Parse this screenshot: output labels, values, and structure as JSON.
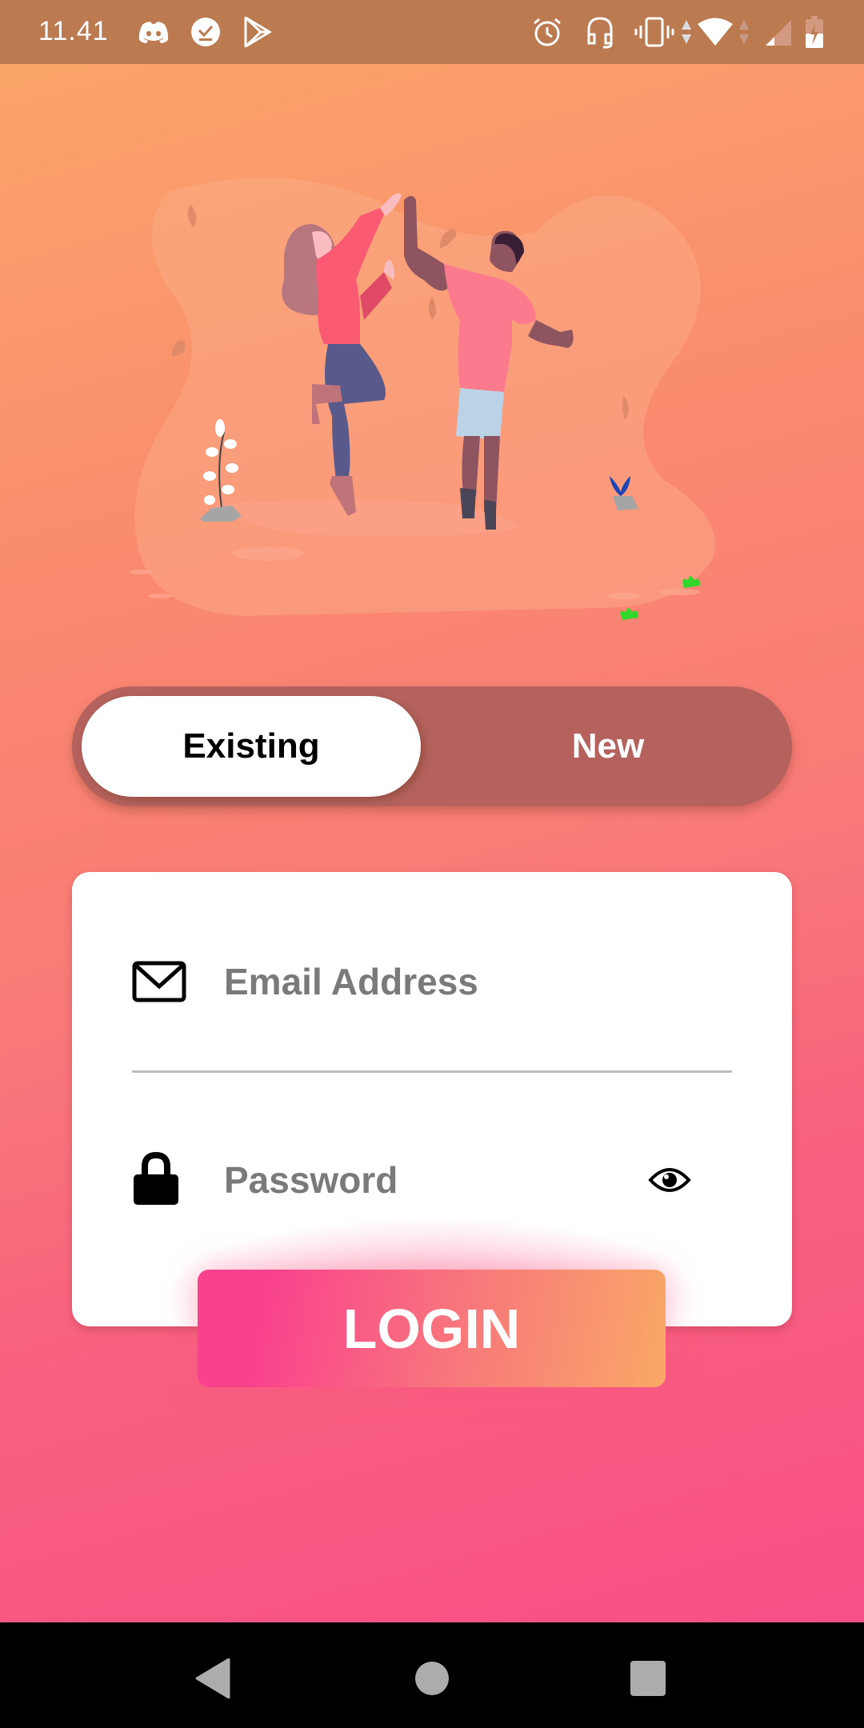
{
  "status_bar": {
    "time": "11.41",
    "left_icons": [
      "discord-icon",
      "download-done-icon",
      "play-store-icon"
    ],
    "right_icons": [
      "alarm-icon",
      "headset-icon",
      "vibrate-icon",
      "data-arrows-icon",
      "wifi-icon",
      "signal-icon",
      "battery-charging-icon"
    ]
  },
  "illustration": {
    "description": "two people high-fiving",
    "icon": "high-five-illustration"
  },
  "account_toggle": {
    "options": [
      {
        "label": "Existing",
        "selected": true
      },
      {
        "label": "New",
        "selected": false
      }
    ]
  },
  "login_form": {
    "email": {
      "placeholder": "Email Address",
      "value": "",
      "icon": "envelope-icon"
    },
    "password": {
      "placeholder": "Password",
      "value": "",
      "icon": "lock-icon",
      "toggle_icon": "eye-icon"
    },
    "submit_label": "LOGIN"
  },
  "nav_bar": {
    "buttons": [
      "back",
      "home",
      "recents"
    ]
  },
  "colors": {
    "gradient_top": "#fba869",
    "gradient_bottom": "#f74f86",
    "status_bar": "#bb7a50",
    "toggle_track": "#b5625e",
    "login_start": "#f9428d",
    "login_end": "#f9a866"
  }
}
